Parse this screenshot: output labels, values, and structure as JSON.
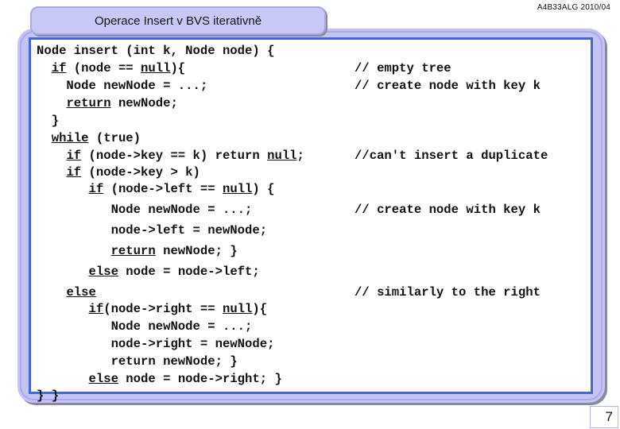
{
  "header": {
    "course_code": "A4B33ALG  2010/04"
  },
  "slide": {
    "title": "Operace Insert v BVS iterativně",
    "page_number": "7"
  },
  "code": {
    "lines": [
      [
        {
          "t": "Node insert (int k, Node node) {"
        }
      ],
      [
        {
          "t": "  "
        },
        {
          "t": "if",
          "u": true
        },
        {
          "t": " (node == "
        },
        {
          "t": "null",
          "u": true
        },
        {
          "t": "){"
        }
      ],
      [
        {
          "t": "    Node newNode = ...;"
        }
      ],
      [
        {
          "t": "    "
        },
        {
          "t": "return",
          "u": true
        },
        {
          "t": " newNode;"
        }
      ],
      [
        {
          "t": "  }"
        }
      ],
      [
        {
          "t": "  "
        },
        {
          "t": "while",
          "u": true
        },
        {
          "t": " (true)"
        }
      ],
      [
        {
          "t": "    "
        },
        {
          "t": "if",
          "u": true
        },
        {
          "t": " (node->key == k) return "
        },
        {
          "t": "null",
          "u": true
        },
        {
          "t": ";"
        }
      ],
      [
        {
          "t": "    "
        },
        {
          "t": "if",
          "u": true
        },
        {
          "t": " (node->key > k)"
        }
      ],
      [
        {
          "t": "       "
        },
        {
          "t": "if",
          "u": true
        },
        {
          "t": " (node->left == "
        },
        {
          "t": "null",
          "u": true
        },
        {
          "t": ") {"
        }
      ],
      [
        {
          "t": "          Node newNode = ...;"
        }
      ],
      [
        {
          "t": "          node->left = newNode;"
        }
      ],
      [
        {
          "t": "          "
        },
        {
          "t": "return",
          "u": true
        },
        {
          "t": " newNode; }"
        }
      ],
      [
        {
          "t": "       "
        },
        {
          "t": "else",
          "u": true
        },
        {
          "t": " node = node->left;"
        }
      ],
      [
        {
          "t": "    "
        },
        {
          "t": "else",
          "u": true
        }
      ],
      [
        {
          "t": "       "
        },
        {
          "t": "if",
          "u": true
        },
        {
          "t": "(node->right == "
        },
        {
          "t": "null",
          "u": true
        },
        {
          "t": "){"
        }
      ],
      [
        {
          "t": "          Node newNode = ...;"
        }
      ],
      [
        {
          "t": "          node->right = newNode;"
        }
      ],
      [
        {
          "t": "          return newNode; }"
        }
      ],
      [
        {
          "t": "       "
        },
        {
          "t": "else",
          "u": true
        },
        {
          "t": " node = node->right; }"
        }
      ],
      [
        {
          "t": "} }"
        }
      ]
    ],
    "line_tops": [
      0,
      22,
      44,
      66,
      88,
      110,
      132,
      153,
      174,
      200,
      226,
      252,
      278,
      304,
      325,
      347,
      369,
      391,
      413,
      434
    ],
    "comments": [
      {
        "line": 1,
        "text": "// empty tree"
      },
      {
        "line": 2,
        "text": "// create node with key k"
      },
      {
        "line": 6,
        "text": "//can't insert a duplicate"
      },
      {
        "line": 9,
        "text": "// create node with key k"
      },
      {
        "line": 13,
        "text": "// similarly to the right"
      }
    ]
  }
}
